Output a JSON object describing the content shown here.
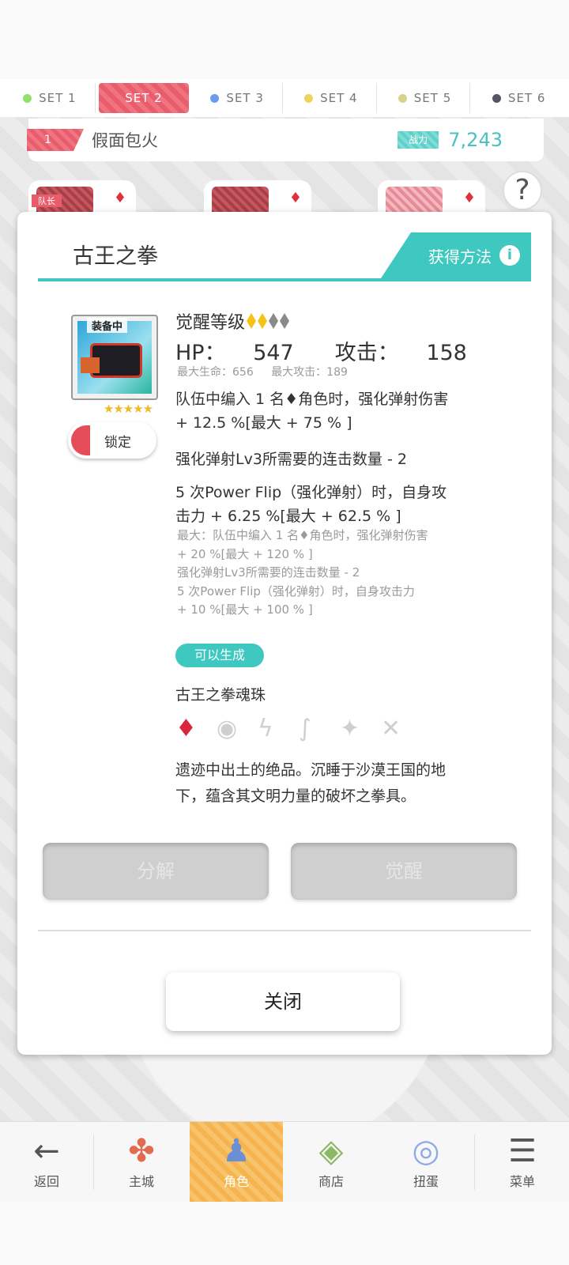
{
  "sets": [
    {
      "label": "SET 1",
      "color": "#8ee26b"
    },
    {
      "label": "SET 2",
      "color": "#ffffff"
    },
    {
      "label": "SET 3",
      "color": "#6c9cf0"
    },
    {
      "label": "SET 4",
      "color": "#f0d35c"
    },
    {
      "label": "SET 5",
      "color": "#d9d28a"
    },
    {
      "label": "SET 6",
      "color": "#555566"
    }
  ],
  "team": {
    "number": "1",
    "name": "假面包火",
    "power_label": "战力",
    "power_value": "7,243"
  },
  "slots": {
    "leader_label": "队长"
  },
  "modal": {
    "title": "古王之拳",
    "acquire_label": "获得方法",
    "equipped_label": "装备中",
    "stars": "★★★★★",
    "lock_label": "锁定",
    "awaken_label": "觉醒等级",
    "hp_label": "HP：",
    "hp_value": "547",
    "atk_label": "攻击：",
    "atk_value": "158",
    "max_hp": "最大生命：656",
    "max_atk": "最大攻击：189",
    "effect1_line1": "队伍中编入 1 名♦角色时，强化弹射伤害",
    "effect1_line2": "+ 12.5 %[最大 + 75 % ]",
    "effect2": "强化弹射Lv3所需要的连击数量 - 2",
    "effect3_line1": "5 次Power Flip（强化弹射）时，自身攻",
    "effect3_line2": "击力 + 6.25 %[最大 + 62.5 % ]",
    "max_note_lines": [
      "最大：队伍中编入 1 名♦角色时，强化弹射伤害",
      "+ 20 %[最大 + 120 % ]",
      "强化弹射Lv3所需要的连击数量 - 2",
      "5 次Power Flip（强化弹射）时，自身攻击力",
      "+ 10 %[最大 + 100 % ]"
    ],
    "craft_tag": "可以生成",
    "soul_name": "古王之拳魂珠",
    "desc_line1": "遗迹中出土的绝品。沉睡于沙漠王国的地",
    "desc_line2": "下，蕴含其文明力量的破坏之拳具。",
    "dismantle_label": "分解",
    "awaken_button_label": "觉醒",
    "close_label": "关闭"
  },
  "nav": [
    {
      "label": "返回",
      "icon": "back-arrow-icon"
    },
    {
      "label": "主城",
      "icon": "town-icon"
    },
    {
      "label": "角色",
      "icon": "character-icon"
    },
    {
      "label": "商店",
      "icon": "shop-icon"
    },
    {
      "label": "扭蛋",
      "icon": "gacha-icon"
    },
    {
      "label": "菜单",
      "icon": "menu-icon"
    }
  ]
}
